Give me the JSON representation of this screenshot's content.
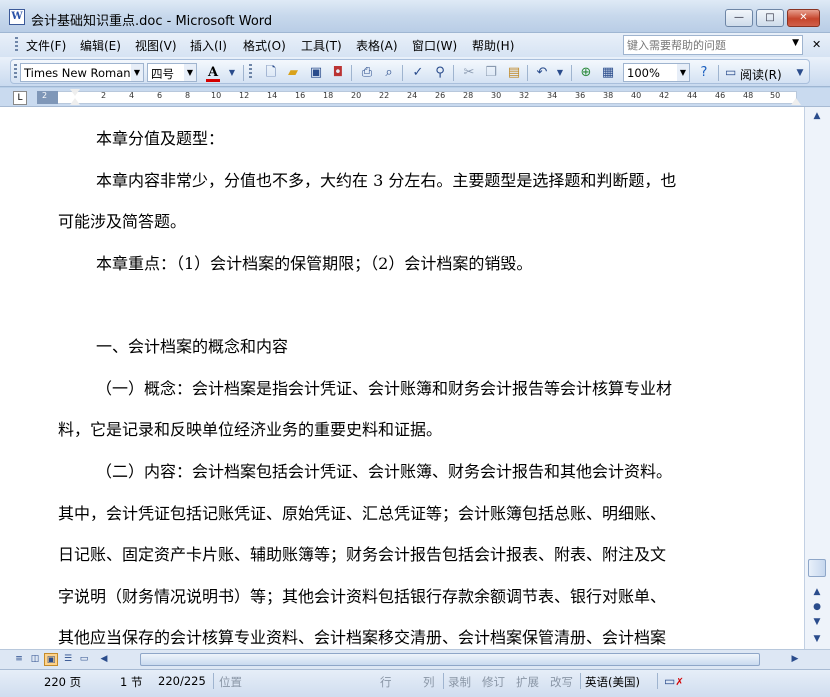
{
  "window": {
    "title": "会计基础知识重点.doc - Microsoft Word",
    "minimize_label": "—",
    "maximize_label": "□",
    "close_label": "✕"
  },
  "menu": {
    "items": [
      "文件(F)",
      "编辑(E)",
      "视图(V)",
      "插入(I)",
      "格式(O)",
      "工具(T)",
      "表格(A)",
      "窗口(W)",
      "帮助(H)"
    ],
    "help_placeholder": "键入需要帮助的问题"
  },
  "toolbar": {
    "font_name": "Times New Roman",
    "font_size": "四号",
    "zoom": "100%",
    "read_label": "阅读(R)",
    "font_color_label": "A",
    "icons": [
      "new-icon",
      "open-icon",
      "save-icon",
      "permission-icon",
      "print-icon",
      "print-preview-icon",
      "spelling-icon",
      "research-icon",
      "cut-icon",
      "copy-icon",
      "paste-icon",
      "undo-icon",
      "hyperlink-icon",
      "table-icon",
      "help-icon",
      "read-icon"
    ]
  },
  "ruler": {
    "ticks": [
      "2",
      "2",
      "4",
      "6",
      "8",
      "10",
      "12",
      "14",
      "16",
      "18",
      "20",
      "22",
      "24",
      "26",
      "28",
      "30",
      "32",
      "34",
      "36",
      "38",
      "40",
      "42",
      "44",
      "46",
      "48",
      "50"
    ],
    "corner_label": "L"
  },
  "document": {
    "lines": [
      "本章分值及题型：",
      "本章内容非常少，分值也不多，大约在 3 分左右。主要题型是选择题和判断题，也",
      "可能涉及简答题。",
      "本章重点：（1）会计档案的保管期限；（2）会计档案的销毁。",
      "一、会计档案的概念和内容",
      "（一）概念：会计档案是指会计凭证、会计账簿和财务会计报告等会计核算专业材",
      "料，它是记录和反映单位经济业务的重要史料和证据。",
      "（二）内容：会计档案包括会计凭证、会计账簿、财务会计报告和其他会计资料。",
      "其中，会计凭证包括记账凭证、原始凭证、汇总凭证等；会计账簿包括总账、明细账、",
      "日记账、固定资产卡片账、辅助账簿等；财务会计报告包括会计报表、附表、附注及文",
      "字说明（财务情况说明书）等；其他会计资料包括银行存款余额调节表、银行对账单、",
      "其他应当保存的会计核算专业资料、会计档案移交清册、会计档案保管清册、会计档案"
    ]
  },
  "status_bar": {
    "page": "220 页",
    "section": "1 节",
    "page_of": "220/225",
    "position": "位置",
    "line": "行",
    "column": "列",
    "record": "录制",
    "revise": "修订",
    "extend": "扩展",
    "overtype": "改写",
    "language": "英语(美国)"
  },
  "colors": {
    "chrome": "#c9daef",
    "font_color_accent": "#d40000",
    "close_button": "#c6452c"
  }
}
